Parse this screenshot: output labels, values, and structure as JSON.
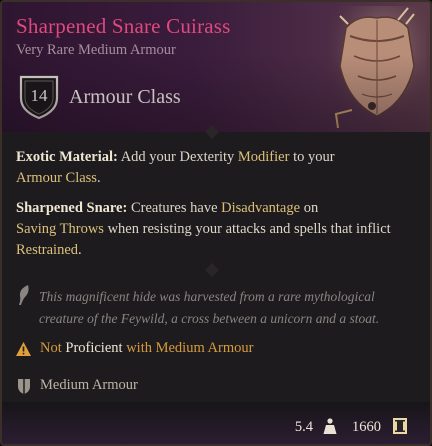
{
  "item": {
    "name": "Sharpened Snare Cuirass",
    "subtitle": "Very Rare Medium Armour",
    "rarity_color": "#e0487f"
  },
  "armour_class": {
    "value": "14",
    "label": "Armour Class"
  },
  "properties": [
    {
      "title": "Exotic Material:",
      "parts": [
        {
          "text": " Add your Dexterity ",
          "hl": false
        },
        {
          "text": "Modifier",
          "hl": true
        },
        {
          "text": " to your ",
          "hl": false
        },
        {
          "text": "Armour Class",
          "hl": true
        },
        {
          "text": ".",
          "hl": false
        }
      ]
    },
    {
      "title": "Sharpened Snare:",
      "parts": [
        {
          "text": " Creatures have ",
          "hl": false
        },
        {
          "text": "Disadvantage",
          "hl": true
        },
        {
          "text": " on ",
          "hl": false
        },
        {
          "text": "Saving Throws",
          "hl": true
        },
        {
          "text": " when resisting your attacks and spells that inflict ",
          "hl": false
        },
        {
          "text": "Restrained",
          "hl": true
        },
        {
          "text": ".",
          "hl": false
        }
      ]
    }
  ],
  "lore": "This magnificent hide was harvested from a rare mythological creature of the Feywild, a cross between a unicorn and a stoat.",
  "proficiency_warning": {
    "part1": "Not ",
    "part2": "Proficient",
    "part3": " with Medium Armour"
  },
  "armour_type": "Medium Armour",
  "footer": {
    "weight": "5.4",
    "value": "1660"
  },
  "icons": {
    "shield": "shield-icon",
    "lore": "feather-icon",
    "warning": "warning-icon",
    "armour_type": "medium-armour-icon",
    "weight": "weight-icon",
    "gold": "gold-coin-icon"
  }
}
